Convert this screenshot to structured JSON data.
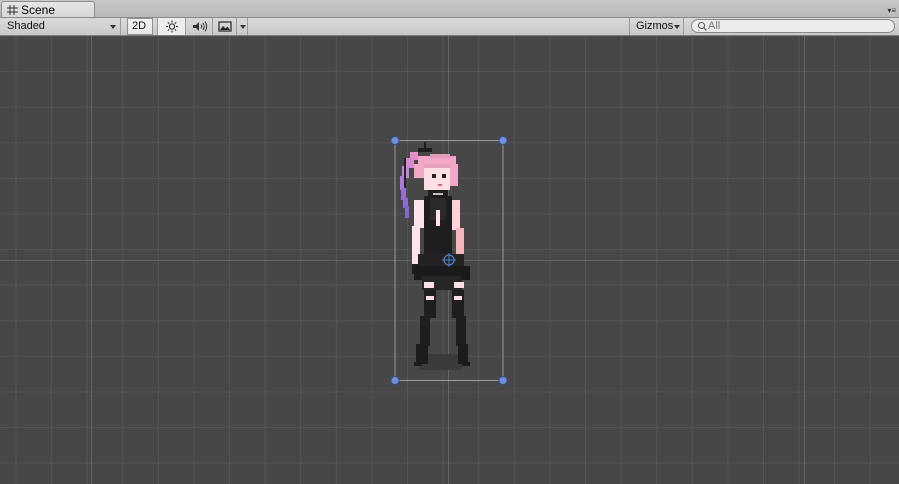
{
  "tab": {
    "title": "Scene",
    "icon": "grid-icon"
  },
  "toolbar": {
    "draw_mode": "Shaded",
    "mode_2d": "2D",
    "lighting_icon": "sun-icon",
    "audio_icon": "speaker-icon",
    "effects_icon": "image-icon",
    "gizmos_label": "Gizmos",
    "search_placeholder": "All"
  },
  "colors": {
    "viewport_bg": "#474747",
    "selection_handle": "#6f8fd8",
    "hair_pink": "#f2a8c6",
    "hair_purple": "#9a6bd1",
    "outfit_black": "#1e1e1e"
  }
}
